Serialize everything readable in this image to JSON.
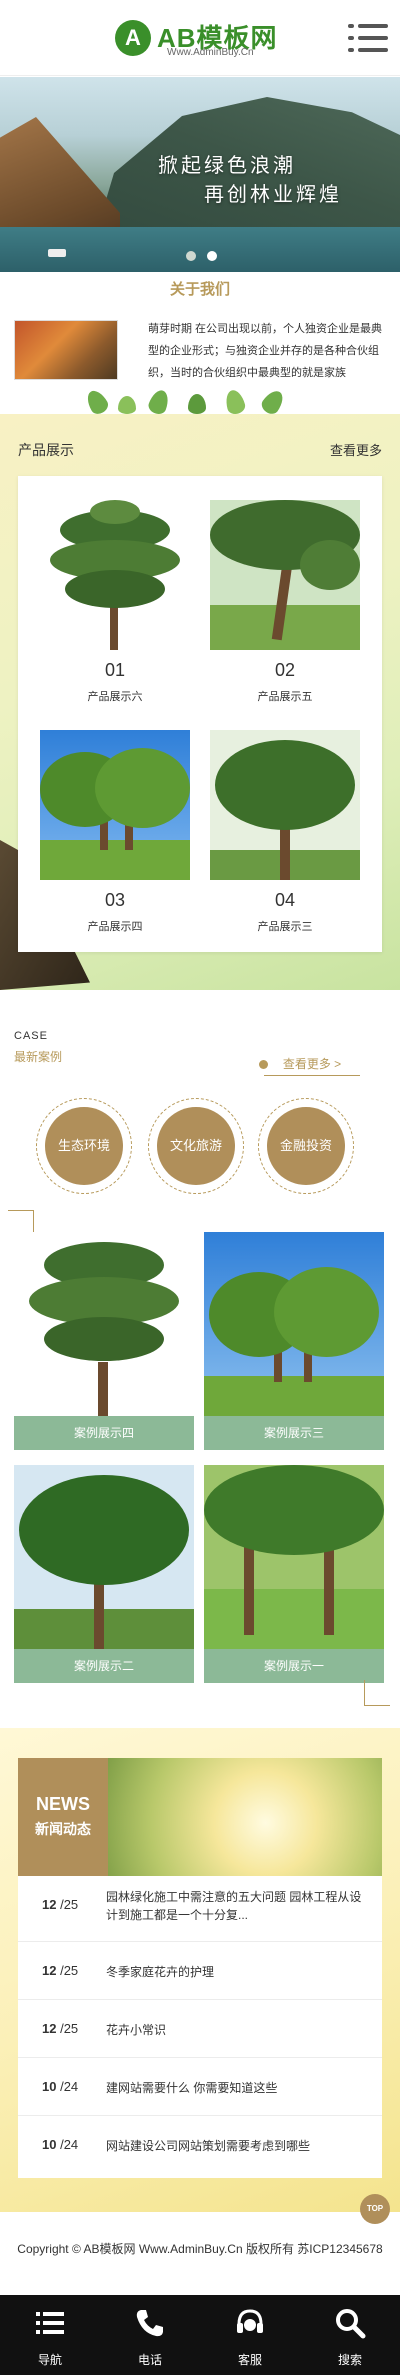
{
  "header": {
    "logo_mark": "A",
    "logo_title": "AB模板网",
    "logo_sub": "Www.AdminBuy.Cn",
    "menu_icon": "hamburger-menu-icon"
  },
  "banner": {
    "line1": "掀起绿色浪潮",
    "line2": "再创林业辉煌",
    "slides_count": 2,
    "active_slide": 2
  },
  "about": {
    "title": "关于我们",
    "text": "萌芽时期 在公司出现以前，个人独资企业是最典型的企业形式；与独资企业并存的是各种合伙组织，当时的合伙组织中最典型的就是家族"
  },
  "product": {
    "title": "产品展示",
    "more": "查看更多",
    "items": [
      {
        "num": "01",
        "name": "产品展示六"
      },
      {
        "num": "02",
        "name": "产品展示五"
      },
      {
        "num": "03",
        "name": "产品展示四"
      },
      {
        "num": "04",
        "name": "产品展示三"
      }
    ]
  },
  "cases": {
    "label": "CASE",
    "title": "最新案例",
    "more": "查看更多 >",
    "categories": [
      "生态环境",
      "文化旅游",
      "金融投资"
    ],
    "items": [
      {
        "name": "案例展示四"
      },
      {
        "name": "案例展示三"
      },
      {
        "name": "案例展示二"
      },
      {
        "name": "案例展示一"
      }
    ]
  },
  "news": {
    "tag_en": "NEWS",
    "tag_cn": "新闻动态",
    "items": [
      {
        "day": "12",
        "month": "/25",
        "title": "园林绿化施工中需注意的五大问题 园林工程从设计到施工都是一个十分复..."
      },
      {
        "day": "12",
        "month": "/25",
        "title": "冬季家庭花卉的护理"
      },
      {
        "day": "12",
        "month": "/25",
        "title": "花卉小常识"
      },
      {
        "day": "10",
        "month": "/24",
        "title": "建网站需要什么 你需要知道这些"
      },
      {
        "day": "10",
        "month": "/24",
        "title": "网站建设公司网站策划需要考虑到哪些"
      }
    ],
    "top_label": "TOP"
  },
  "footer": {
    "copyright": "Copyright © AB模板网 Www.AdminBuy.Cn 版权所有  苏ICP12345678"
  },
  "bottom_nav": [
    {
      "label": "导航",
      "icon": "list-icon"
    },
    {
      "label": "电话",
      "icon": "phone-icon"
    },
    {
      "label": "客服",
      "icon": "headset-icon"
    },
    {
      "label": "搜索",
      "icon": "search-icon"
    }
  ],
  "colors": {
    "brand_green": "#3a8f2a",
    "accent_gold": "#b79a5b",
    "case_caption": "#8cb997",
    "nav_bg": "#111111"
  }
}
